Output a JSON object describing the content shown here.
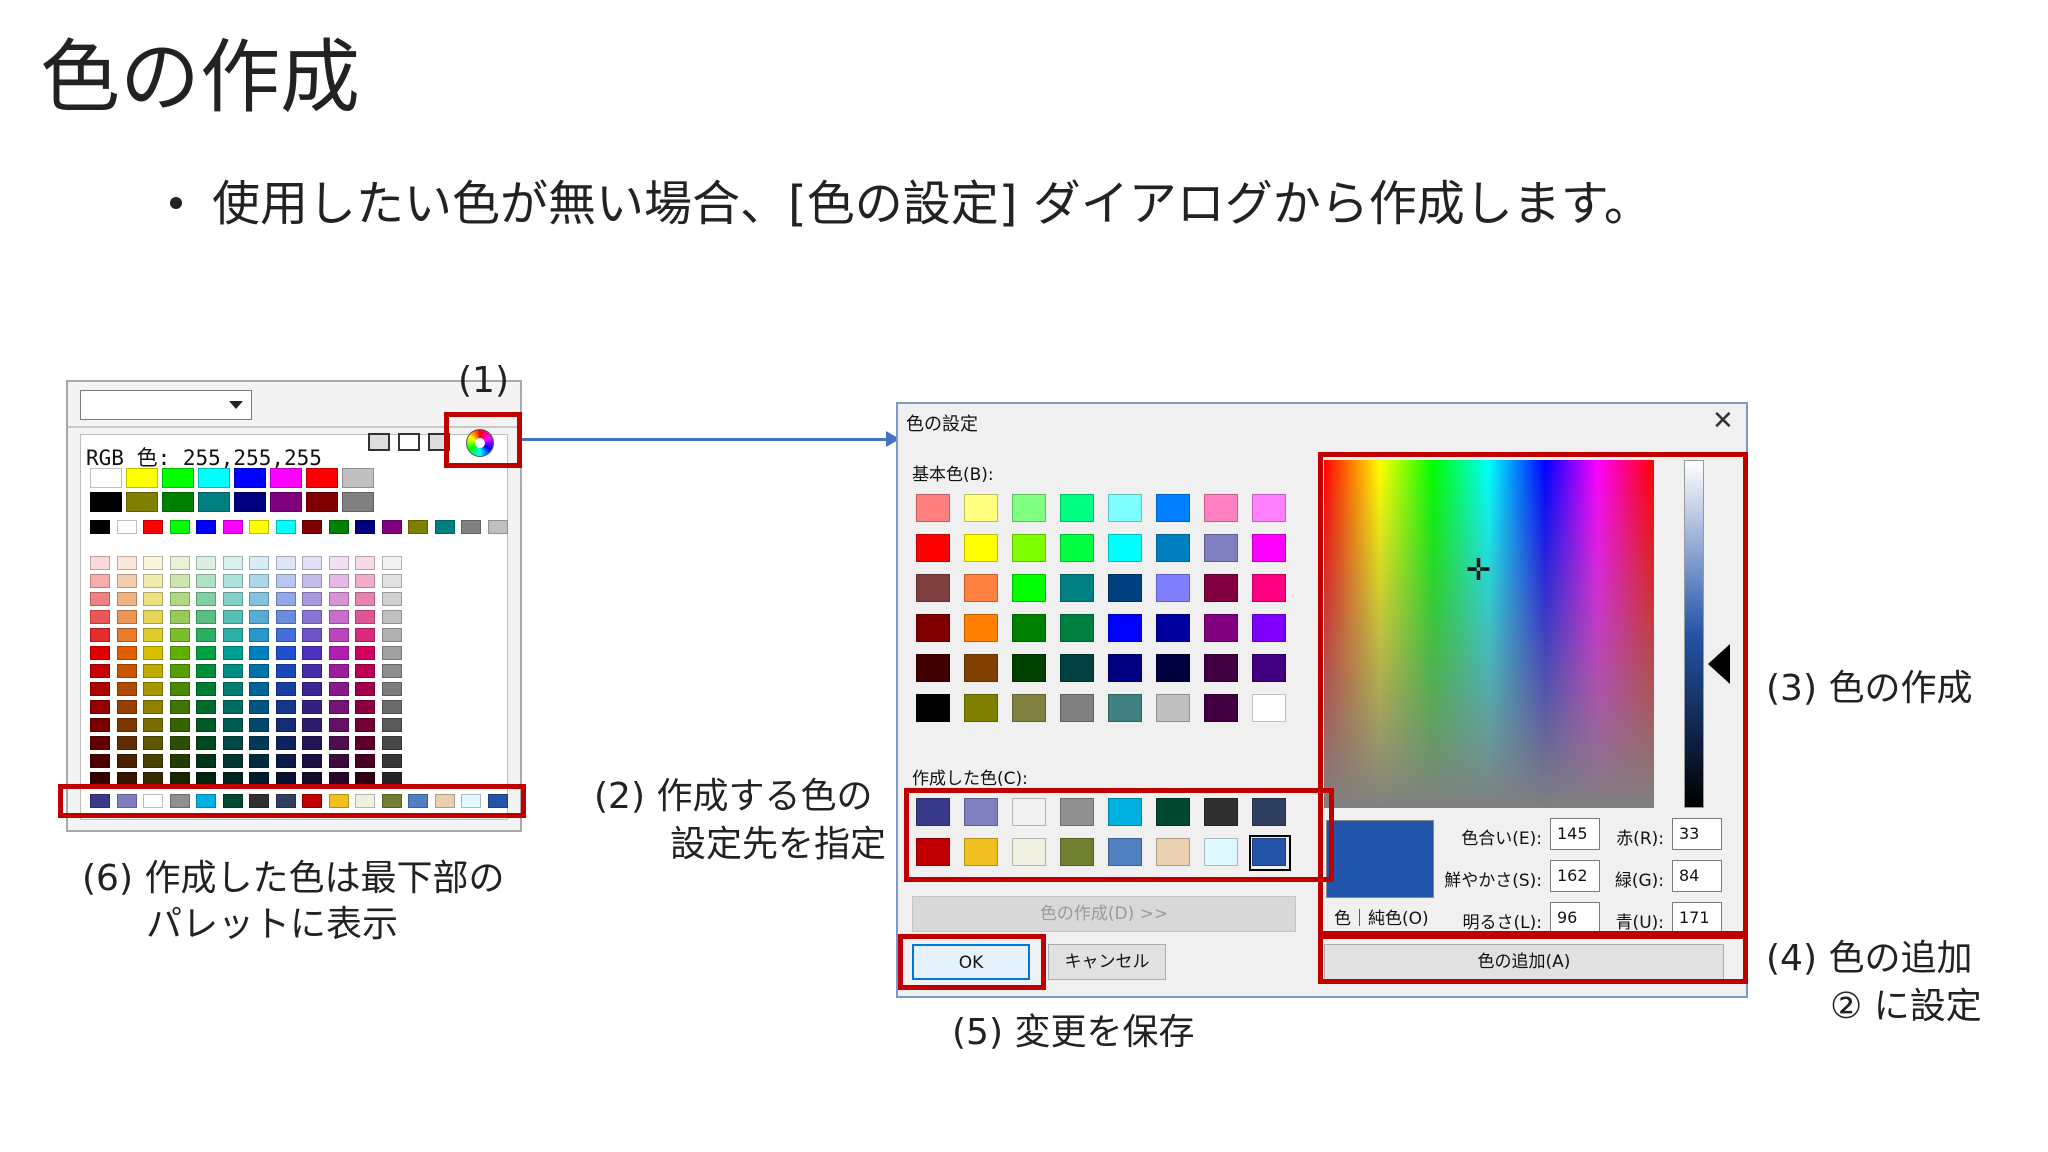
{
  "slide": {
    "title": "色の作成",
    "bullet": "使用したい色が無い場合、[色の設定] ダイアログから作成します。"
  },
  "palette_window": {
    "rgb_label": "RGB 色: 255,255,255",
    "top_rows": [
      [
        "#ffffff",
        "#ffff00",
        "#00ff00",
        "#00ffff",
        "#0000ff",
        "#ff00ff",
        "#ff0000",
        "#c0c0c0"
      ],
      [
        "#000000",
        "#808000",
        "#008000",
        "#008080",
        "#000080",
        "#800080",
        "#800000",
        "#808080"
      ]
    ],
    "small_row": [
      "#000000",
      "#ffffff",
      "#ff0000",
      "#00ff00",
      "#0000ff",
      "#ff00ff",
      "#ffff00",
      "#00ffff",
      "#800000",
      "#008000",
      "#000080",
      "#800080",
      "#808000",
      "#008080",
      "#808080",
      "#c0c0c0"
    ],
    "grid_hues": [
      "#e00000",
      "#e06000",
      "#d8c000",
      "#60b000",
      "#00a040",
      "#00a090",
      "#0080c0",
      "#2050d0",
      "#5030c0",
      "#b020b0",
      "#d00060",
      "#a0a0a0"
    ],
    "bottom_row": [
      "#3a3a8a",
      "#8080c0",
      "#ffffff",
      "#909090",
      "#00b0e0",
      "#004830",
      "#303030",
      "#304060",
      "#c00000",
      "#f0c020",
      "#f0f0e0",
      "#708030",
      "#5080c0",
      "#e8d0b0",
      "#e0f8ff",
      "#2454a8"
    ]
  },
  "dialog": {
    "title": "色の設定",
    "close_glyph": "✕",
    "basic_label": "基本色(B):",
    "basic_colors": [
      [
        "#ff8080",
        "#ffff80",
        "#80ff80",
        "#00ff80",
        "#80ffff",
        "#0080ff",
        "#ff80c0",
        "#ff80ff"
      ],
      [
        "#ff0000",
        "#ffff00",
        "#80ff00",
        "#00ff40",
        "#00ffff",
        "#0080c0",
        "#8080c0",
        "#ff00ff"
      ],
      [
        "#804040",
        "#ff8040",
        "#00ff00",
        "#008080",
        "#004080",
        "#8080ff",
        "#800040",
        "#ff0080"
      ],
      [
        "#800000",
        "#ff8000",
        "#008000",
        "#008040",
        "#0000ff",
        "#0000a0",
        "#800080",
        "#8000ff"
      ],
      [
        "#400000",
        "#804000",
        "#004000",
        "#004040",
        "#000080",
        "#000040",
        "#400040",
        "#400080"
      ],
      [
        "#000000",
        "#808000",
        "#808040",
        "#808080",
        "#408080",
        "#c0c0c0",
        "#400040",
        "#ffffff"
      ]
    ],
    "custom_label": "作成した色(C):",
    "custom_colors": [
      [
        "#3a3a8a",
        "#8080c0",
        "#f0f0f0",
        "#909090",
        "#00b0e0",
        "#004830",
        "#303030",
        "#304060"
      ],
      [
        "#c00000",
        "#f0c020",
        "#f0f0e0",
        "#708030",
        "#5080c0",
        "#e8d0b0",
        "#e0f8ff",
        "#2454a8"
      ]
    ],
    "define_button": "色の作成(D) >>",
    "ok_button": "OK",
    "cancel_button": "キャンセル",
    "color_solid_label": "色｜純色(O)",
    "hue_label": "色合い(E):",
    "hue": "145",
    "sat_label": "鮮やかさ(S):",
    "sat": "162",
    "lum_label": "明るさ(L):",
    "lum": "96",
    "red_label": "赤(R):",
    "red": "33",
    "green_label": "緑(G):",
    "green": "84",
    "blue_label": "青(U):",
    "blue": "171",
    "add_button": "色の追加(A)",
    "preview_color": "#2154ab"
  },
  "annotations": {
    "a1": "(1)",
    "a2_line1": "(2) 作成する色の",
    "a2_line2": "設定先を指定",
    "a3": "(3) 色の作成",
    "a4_line1": "(4) 色の追加",
    "a4_line2": "② に設定",
    "a5": "(5) 変更を保存",
    "a6_line1": "(6) 作成した色は最下部の",
    "a6_line2": "パレットに表示"
  },
  "colors": {
    "highlight": "#c00000",
    "arrow": "#4472c4"
  }
}
